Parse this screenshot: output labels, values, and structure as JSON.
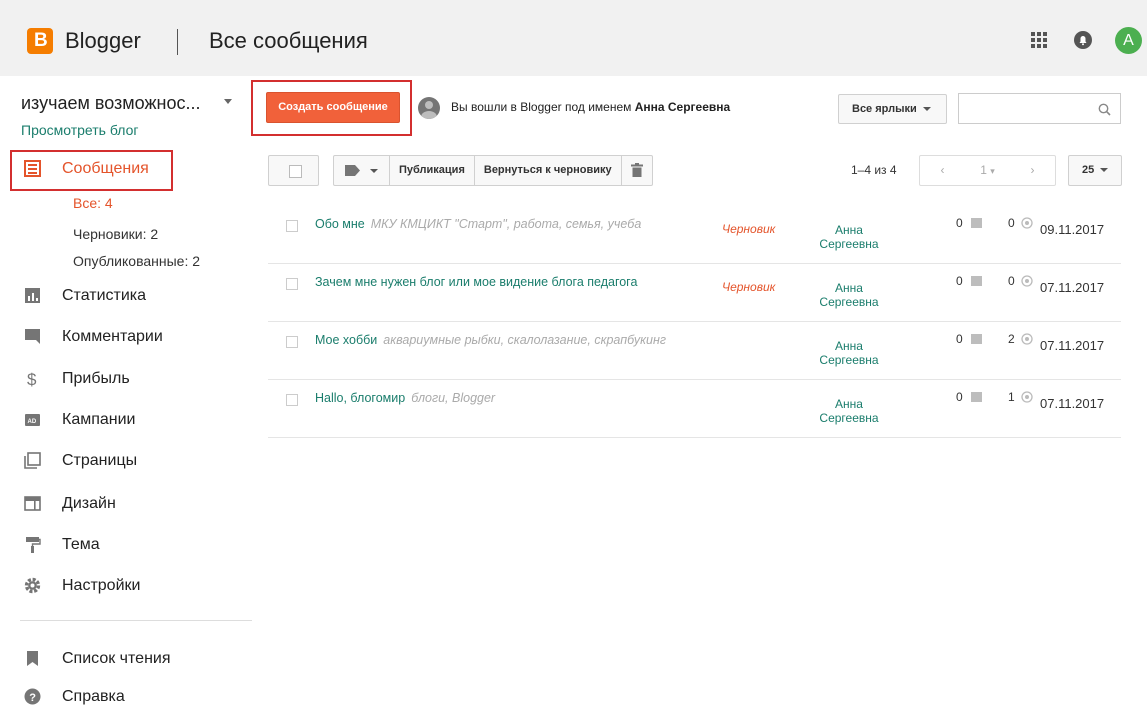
{
  "header": {
    "brand": "Blogger",
    "page_title": "Все сообщения",
    "avatar_letter": "A"
  },
  "sidebar": {
    "blog_name": "изучаем возможнос...",
    "view_blog": "Просмотреть блог",
    "posts_label": "Сообщения",
    "sub_items": [
      {
        "label": "Все: 4",
        "active": true
      },
      {
        "label": "Черновики: 2",
        "active": false
      },
      {
        "label": "Опубликованные: 2",
        "active": false
      }
    ],
    "items": [
      {
        "label": "Статистика",
        "icon": "stats-icon"
      },
      {
        "label": "Комментарии",
        "icon": "comments-icon"
      },
      {
        "label": "Прибыль",
        "icon": "dollar-icon"
      },
      {
        "label": "Кампании",
        "icon": "ad-icon"
      },
      {
        "label": "Страницы",
        "icon": "pages-icon"
      },
      {
        "label": "Дизайн",
        "icon": "layout-icon"
      },
      {
        "label": "Тема",
        "icon": "paint-roller-icon"
      },
      {
        "label": "Настройки",
        "icon": "gear-icon"
      }
    ],
    "bottom_items": [
      {
        "label": "Список чтения",
        "icon": "bookmark-icon"
      },
      {
        "label": "Справка",
        "icon": "help-icon"
      }
    ]
  },
  "toolbar": {
    "create_label": "Создать сообщение",
    "signed_in_prefix": "Вы вошли в Blogger под именем",
    "user_name": "Анна Сергеевна",
    "labels_dropdown": "Все ярлыки",
    "publish_label": "Публикация",
    "revert_label": "Вернуться к черновику",
    "count_text": "1–4 из 4",
    "page_number": "1",
    "per_page": "25"
  },
  "posts": [
    {
      "title": "Обо мне",
      "tags": "МКУ КМЦИКТ \"Старт\", работа, семья, учеба",
      "status": "Черновик",
      "author": "Анна Сергеевна",
      "comments": "0",
      "views": "0",
      "date": "09.11.2017"
    },
    {
      "title": "Зачем мне нужен блог или мое видение блога педагога",
      "tags": "",
      "status": "Черновик",
      "author": "Анна Сергеевна",
      "comments": "0",
      "views": "0",
      "date": "07.11.2017"
    },
    {
      "title": "Мое хобби",
      "tags": "аквариумные рыбки, скалолазание, скрапбукинг",
      "status": "",
      "author": "Анна Сергеевна",
      "comments": "0",
      "views": "2",
      "date": "07.11.2017"
    },
    {
      "title": "Hallo, блогомир",
      "tags": "блоги, Blogger",
      "status": "",
      "author": "Анна Сергеевна",
      "comments": "0",
      "views": "1",
      "date": "07.11.2017"
    }
  ],
  "colors": {
    "accent": "#f1613a",
    "brand_orange": "#f57d00",
    "link": "#1a7d6c",
    "highlight": "#d32f2f"
  }
}
